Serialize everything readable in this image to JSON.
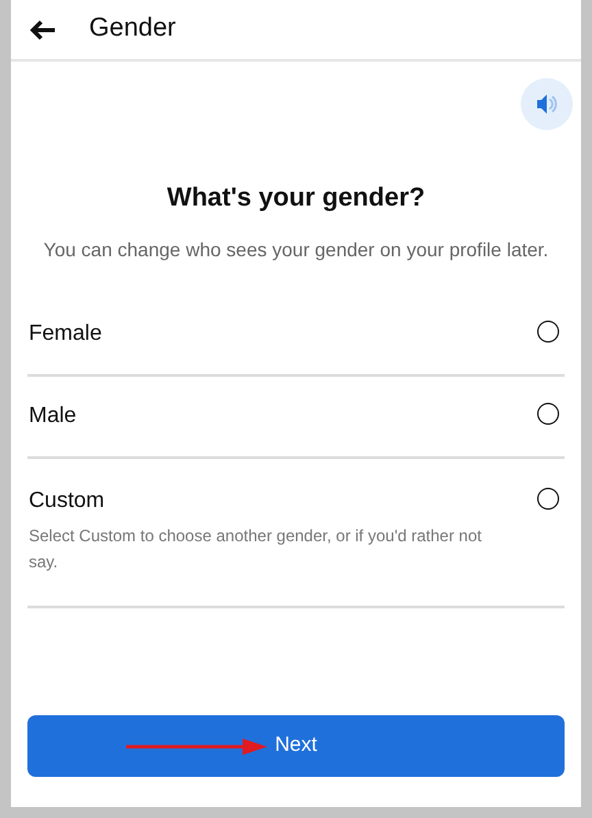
{
  "header": {
    "title": "Gender"
  },
  "heading": "What's your gender?",
  "subtitle": "You can change who sees your gender on your profile later.",
  "options": [
    {
      "label": "Female",
      "selected": false
    },
    {
      "label": "Male",
      "selected": false
    },
    {
      "label": "Custom",
      "description": "Select Custom to choose another gender, or if you'd rather not say.",
      "selected": false
    }
  ],
  "next_button": "Next"
}
